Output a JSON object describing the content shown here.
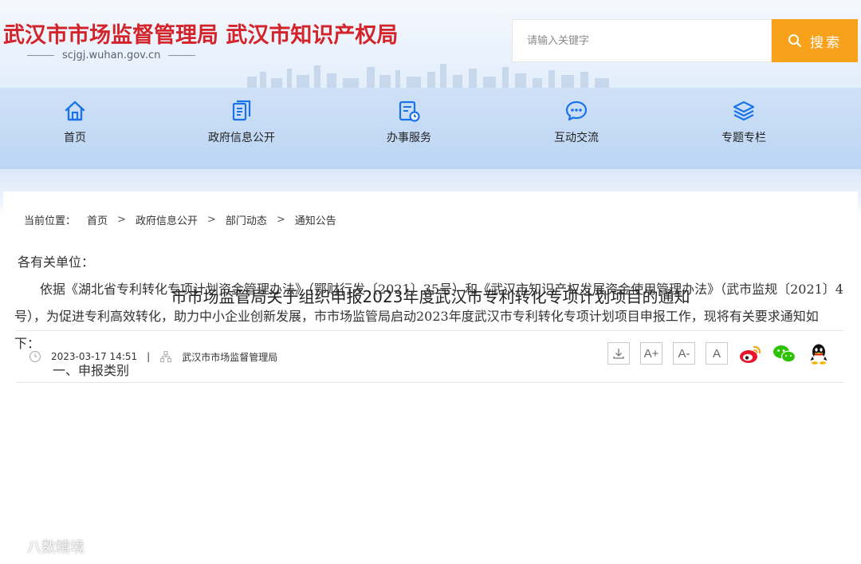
{
  "header": {
    "site_title": "武汉市市场监督管理局 武汉市知识产权局",
    "domain": "scjgj.wuhan.gov.cn",
    "search_placeholder": "请输入关键字",
    "search_button": "搜索"
  },
  "nav": {
    "items": [
      {
        "label": "首页",
        "icon": "home-icon"
      },
      {
        "label": "政府信息公开",
        "icon": "document-icon"
      },
      {
        "label": "办事服务",
        "icon": "service-icon"
      },
      {
        "label": "互动交流",
        "icon": "chat-icon"
      },
      {
        "label": "专题专栏",
        "icon": "layers-icon"
      }
    ]
  },
  "breadcrumb": {
    "prefix": "当前位置：",
    "items": [
      "首页",
      "政府信息公开",
      "部门动态",
      "通知公告"
    ],
    "separator": ">"
  },
  "article": {
    "title": "市市场监管局关于组织申报2023年度武汉市专利转化专项计划项目的通知",
    "datetime": "2023-03-17 14:51",
    "separator": "|",
    "source": "武汉市市场监督管理局",
    "salutation": "各有关单位：",
    "paragraph1": "依据《湖北省专利转化专项计划资金管理办法》（鄂财行发〔2021〕35号）和《武汉市知识产权发展资金使用管理办法》（武市监规〔2021〕4号），为促进专利高效转化，助力中小企业创新发展，市市场监管局启动2023年度武汉市专利转化专项计划项目申报工作，现将有关要求通知如下：",
    "section1": "一、申报类别"
  },
  "tools": {
    "download_icon": "download-icon",
    "font_larger": "A+",
    "font_smaller": "A-",
    "font_default": "A",
    "share": [
      "weibo-icon",
      "wechat-icon",
      "qq-icon"
    ]
  },
  "watermark": "八数精境",
  "colors": {
    "title_red": "#d2242a",
    "search_orange": "#f8a21b",
    "nav_icon_blue": "#1a73e8",
    "weibo": "#e6162d",
    "wechat": "#2dc100"
  }
}
